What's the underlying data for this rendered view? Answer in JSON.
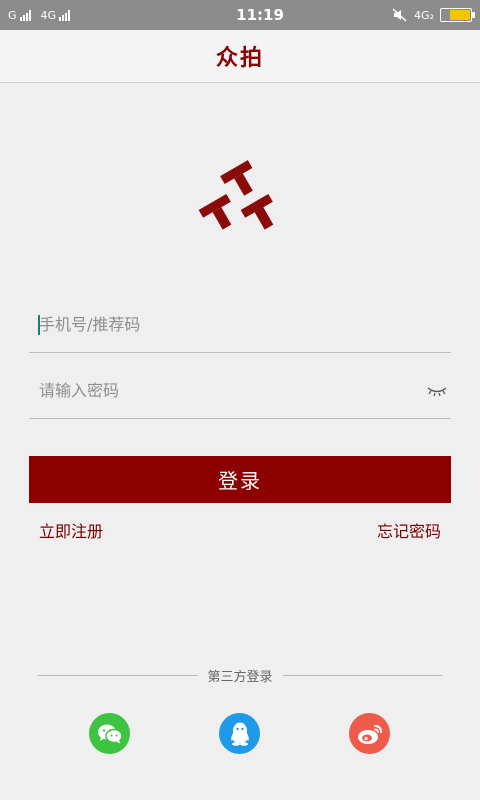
{
  "status_bar": {
    "carrier1": "G",
    "carrier2": "4G",
    "time": "11:19",
    "network_right": "4G₂"
  },
  "header": {
    "title": "众拍"
  },
  "form": {
    "phone_placeholder": "手机号/推荐码",
    "password_placeholder": "请输入密码",
    "login_label": "登录"
  },
  "links": {
    "register": "立即注册",
    "forgot": "忘记密码"
  },
  "third_party": {
    "label": "第三方登录",
    "providers": [
      "wechat",
      "qq",
      "weibo"
    ]
  },
  "colors": {
    "brand": "#8c0000",
    "wechat": "#3dc440",
    "qq": "#1e9ae8",
    "weibo": "#ee5b4a"
  }
}
